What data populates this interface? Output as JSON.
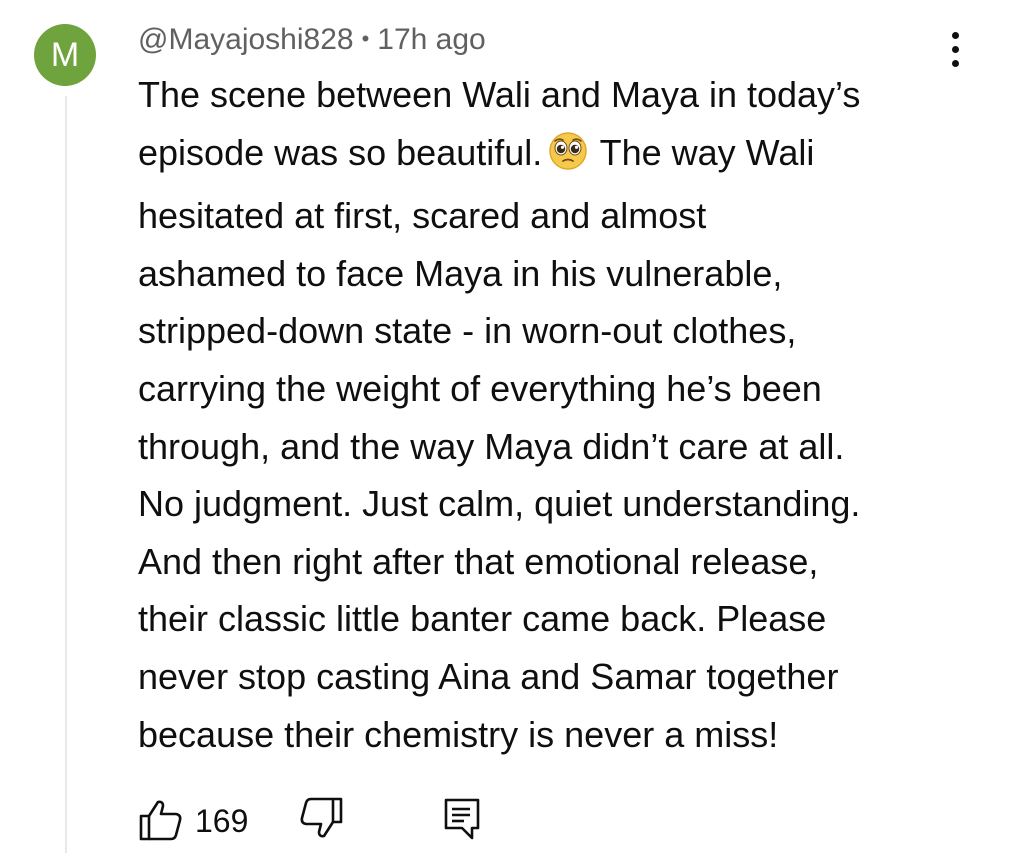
{
  "comment": {
    "avatar_letter": "M",
    "avatar_color": "#6fa33e",
    "author": "@Mayajoshi828",
    "separator": "•",
    "time": "17h ago",
    "text_lines": [
      "The scene between Wali and Maya in today’s",
      "episode was so beautiful.",
      "The way Wali",
      "hesitated at first, scared and almost",
      "ashamed to face Maya in his vulnerable,",
      "stripped-down state - in worn-out clothes,",
      "carrying the weight of everything he’s been",
      "through, and the way Maya didn’t care at all.",
      "No judgment. Just calm, quiet understanding.",
      "And then right after that emotional release,",
      "their classic little banter came back. Please",
      "never stop casting Aina and Samar together",
      "because their chemistry is never a miss!"
    ],
    "emoji": "pleading-face-emoji",
    "like_count": "169"
  },
  "icons": {
    "like": "thumbs-up-icon",
    "dislike": "thumbs-down-icon",
    "reply": "reply-comment-icon",
    "menu": "more-vert-icon"
  }
}
